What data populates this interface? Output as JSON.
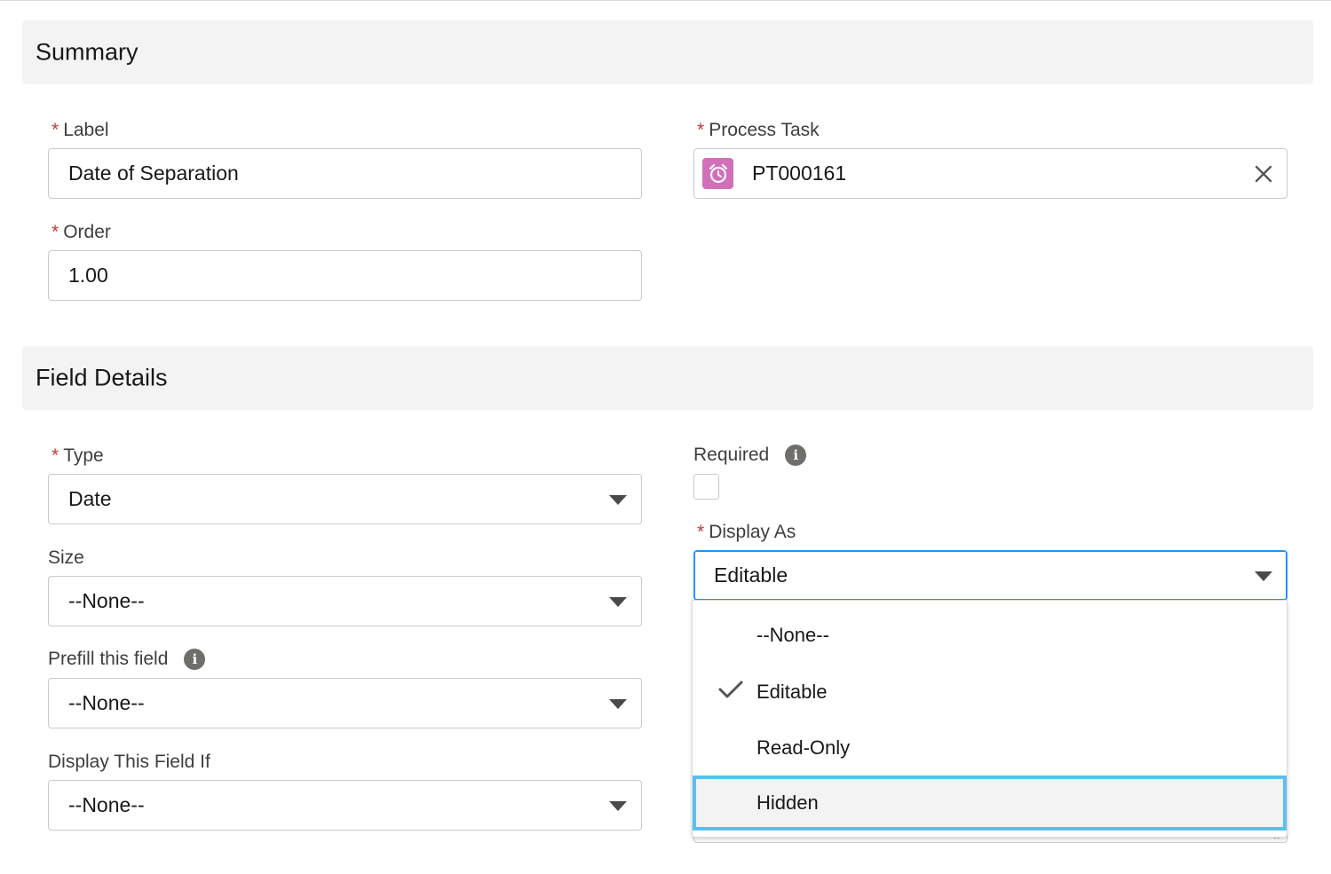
{
  "summary": {
    "title": "Summary",
    "label_field": {
      "required_mark": "*",
      "label": "Label",
      "value": "Date of Separation"
    },
    "process_task_field": {
      "required_mark": "*",
      "label": "Process Task",
      "value": "PT000161",
      "icon": "alarm-clock-icon",
      "icon_color": "#d16fb8"
    },
    "order_field": {
      "required_mark": "*",
      "label": "Order",
      "value": "1.00"
    }
  },
  "field_details": {
    "title": "Field Details",
    "type_field": {
      "required_mark": "*",
      "label": "Type",
      "value": "Date"
    },
    "size_field": {
      "label": "Size",
      "value": "--None--"
    },
    "prefill_field": {
      "label": "Prefill this field",
      "value": "--None--",
      "info_icon": "i"
    },
    "display_if_field": {
      "label": "Display This Field If",
      "value": "--None--"
    },
    "required_field": {
      "label": "Required",
      "checked": false,
      "info_icon": "i"
    },
    "display_as_field": {
      "required_mark": "*",
      "label": "Display As",
      "value": "Editable",
      "options": [
        {
          "label": "--None--",
          "selected": false
        },
        {
          "label": "Editable",
          "selected": true
        },
        {
          "label": "Read-Only",
          "selected": false
        },
        {
          "label": "Hidden",
          "selected": false,
          "highlighted": true
        }
      ]
    }
  },
  "colors": {
    "required": "#c23934",
    "focus": "#1b96ff",
    "highlight_border": "#5bc0f0",
    "section_bg": "#f3f3f3"
  }
}
